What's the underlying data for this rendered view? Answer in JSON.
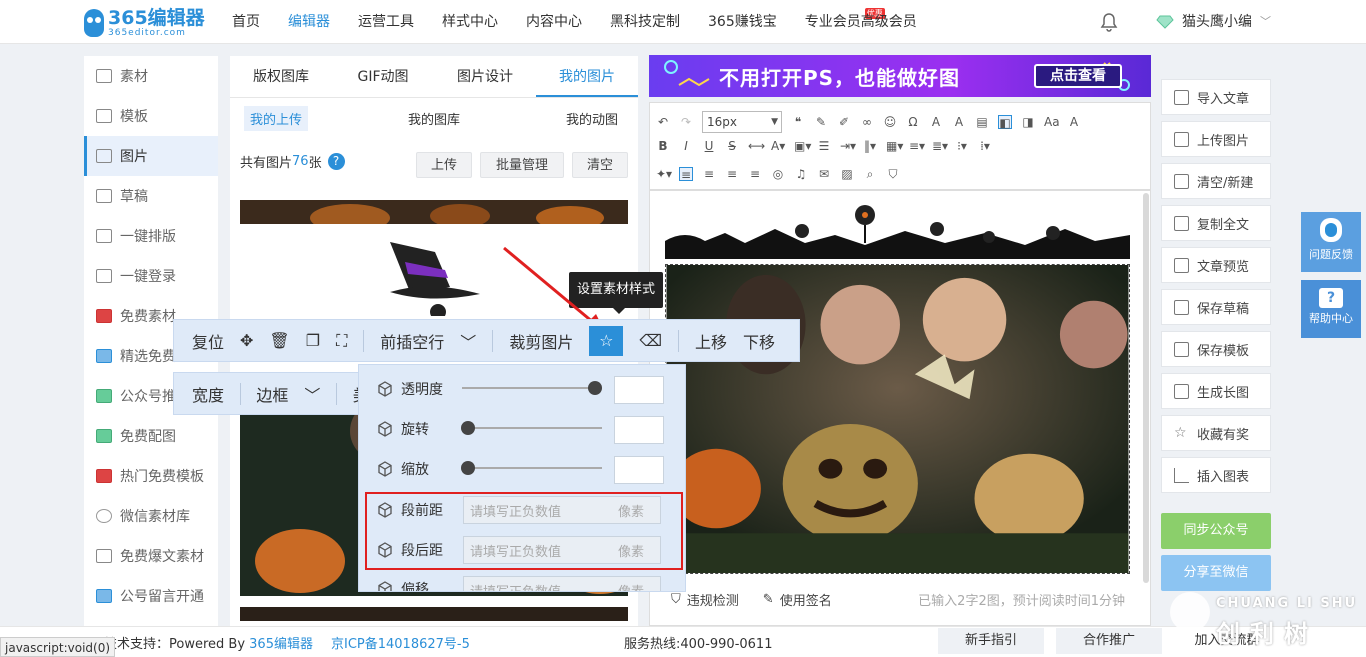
{
  "logo": {
    "main": "365编辑器",
    "sub": "365editor.com"
  },
  "nav": [
    {
      "label": "首页"
    },
    {
      "label": "编辑器",
      "active": true
    },
    {
      "label": "运营工具"
    },
    {
      "label": "样式中心"
    },
    {
      "label": "内容中心"
    },
    {
      "label": "黑科技定制"
    },
    {
      "label": "365赚钱宝"
    },
    {
      "label": "专业会员",
      "badge": "优惠"
    },
    {
      "label": "高级会员"
    }
  ],
  "user": {
    "name": "猫头鹰小编"
  },
  "sidebar": {
    "items": [
      {
        "label": "素材"
      },
      {
        "label": "模板"
      },
      {
        "label": "图片"
      },
      {
        "label": "草稿"
      },
      {
        "label": "一键排版"
      },
      {
        "label": "一键登录"
      },
      {
        "label": "免费素材"
      },
      {
        "label": "精选免费"
      },
      {
        "label": "公众号推"
      },
      {
        "label": "免费配图"
      },
      {
        "label": "热门免费模板"
      },
      {
        "label": "微信素材库"
      },
      {
        "label": "免费爆文素材"
      },
      {
        "label": "公号留言开通"
      }
    ]
  },
  "panel": {
    "tabs": [
      {
        "label": "版权图库"
      },
      {
        "label": "GIF动图"
      },
      {
        "label": "图片设计"
      },
      {
        "label": "我的图片"
      }
    ],
    "subtabs": [
      {
        "label": "我的上传"
      },
      {
        "label": "我的图库"
      },
      {
        "label": "我的动图"
      }
    ],
    "count_prefix": "共有图片",
    "count": "76",
    "count_suffix": "张",
    "help": "?",
    "buttons": {
      "upload": "上传",
      "batch": "批量管理",
      "clear": "清空"
    }
  },
  "banner": {
    "text": "不用打开PS，也能做好图",
    "button": "点击查看"
  },
  "toolbar": {
    "font_size": "16px"
  },
  "float_toolbar": {
    "reset": "复位",
    "insert_before": "前插空行",
    "crop": "裁剪图片",
    "move_up": "上移",
    "move_down": "下移",
    "width": "宽度",
    "border": "边框",
    "beautify": "美化"
  },
  "tooltip": "设置素材样式",
  "style_panel": {
    "opacity": "透明度",
    "rotate": "旋转",
    "scale": "缩放",
    "space_before": "段前距",
    "space_after": "段后距",
    "offset": "偏移",
    "placeholder": "请填写正负数值",
    "unit": "像素",
    "opacity_level": 0.95,
    "rotate_level": 0.04,
    "scale_level": 0.04
  },
  "editor_status": {
    "check": "违规检测",
    "signature": "使用签名",
    "info": "已输入2字2图，预计阅读时间1分钟"
  },
  "right_sidebar": [
    {
      "label": "导入文章"
    },
    {
      "label": "上传图片"
    },
    {
      "label": "清空/新建"
    },
    {
      "label": "复制全文"
    },
    {
      "label": "文章预览"
    },
    {
      "label": "保存草稿"
    },
    {
      "label": "保存模板"
    },
    {
      "label": "生成长图"
    },
    {
      "label": "收藏有奖"
    },
    {
      "label": "插入图表"
    }
  ],
  "right_actions": {
    "sync": "同步公众号",
    "share": "分享至微信"
  },
  "float_help": {
    "feedback": "问题反馈",
    "help": "帮助中心"
  },
  "footer": {
    "support_prefix": "技术支持：Powered By ",
    "brand": "365编辑器",
    "icp": "京ICP备14018627号-5",
    "hotline": "服务热线:400-990-0611",
    "guide": "新手指引",
    "partner": "合作推广",
    "group": "加入交流群"
  },
  "status_bar": "javascript:void(0)",
  "watermark": {
    "latin": "CHUANG LI SHU",
    "cjk": "创利树"
  },
  "colors": {
    "accent": "#2b8fd8",
    "sync": "#8bcf6b",
    "share": "#8cc4f2",
    "highlight": "#e02020"
  }
}
